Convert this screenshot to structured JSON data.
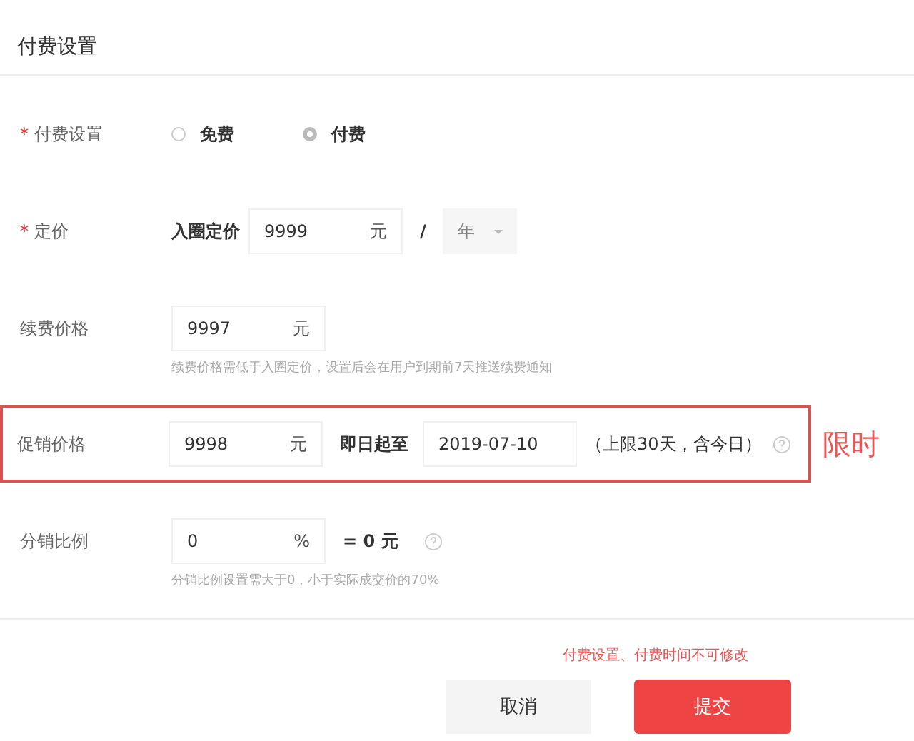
{
  "title": "付费设置",
  "fields": [
    {
      "kind": "radio",
      "label": "付费设置",
      "required_mark": "*",
      "options": [
        {
          "label": "免费",
          "selected": false
        },
        {
          "label": "付费",
          "selected": true
        }
      ]
    },
    {
      "kind": "price",
      "label": "定价",
      "required_mark": "*",
      "prefix": "入圈定价",
      "value": "9999",
      "unit": "元",
      "separator": "/",
      "period": "年"
    },
    {
      "kind": "amount",
      "label": "续费价格",
      "value": "9997",
      "unit": "元",
      "hint": "续费价格需低于入圈定价，设置后会在用户到期前7天推送续费通知"
    },
    {
      "kind": "promo",
      "label": "促销价格",
      "highlighted": true,
      "value": "9998",
      "unit": "元",
      "until_label": "即日起至",
      "date": "2019-07-10",
      "note": "（上限30天，含今日）",
      "help": true,
      "annotation": "限时"
    },
    {
      "kind": "ratio",
      "label": "分销比例",
      "value": "0",
      "unit": "%",
      "result": "= 0 元",
      "help": true,
      "hint": "分销比例设置需大于0，小于实际成交价的70%"
    }
  ],
  "warning": "付费设置、付费时间不可修改",
  "buttons": [
    {
      "label": "取消",
      "kind": "secondary"
    },
    {
      "label": "提交",
      "kind": "primary"
    }
  ]
}
